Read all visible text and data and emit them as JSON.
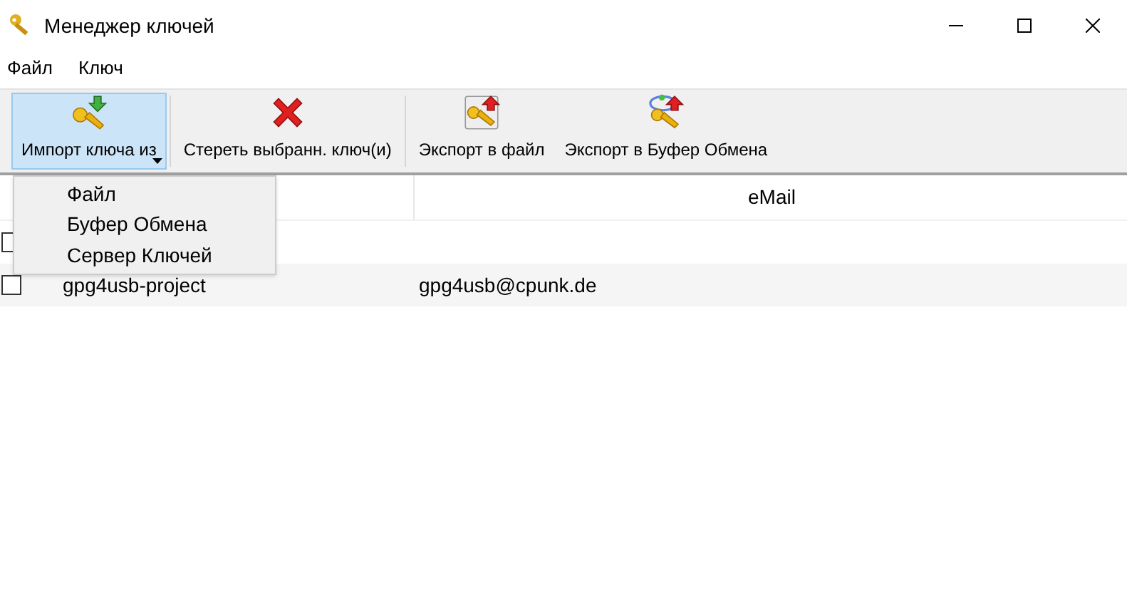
{
  "window": {
    "title": "Менеджер ключей"
  },
  "menu": [
    "Файл",
    "Ключ"
  ],
  "toolbar": [
    {
      "label": "Импорт ключа из",
      "kind": "import",
      "selected": true,
      "dropdown": true
    },
    {
      "label": "Стереть выбранн. ключ(и)",
      "kind": "delete",
      "selected": false,
      "dropdown": false
    },
    {
      "label": "Экспорт в файл",
      "kind": "export-file",
      "selected": false,
      "dropdown": false
    },
    {
      "label": "Экспорт в Буфер Обмена",
      "kind": "export-clipboard",
      "selected": false,
      "dropdown": false
    }
  ],
  "dropdown_menu": [
    "Файл",
    "Буфер Обмена",
    "Сервер Ключей"
  ],
  "table": {
    "columns": [
      "eMail"
    ],
    "rows": [
      {
        "checked": false
      },
      {
        "checked": false,
        "name": "gpg4usb-project",
        "email": "gpg4usb@cpunk.de"
      }
    ]
  }
}
